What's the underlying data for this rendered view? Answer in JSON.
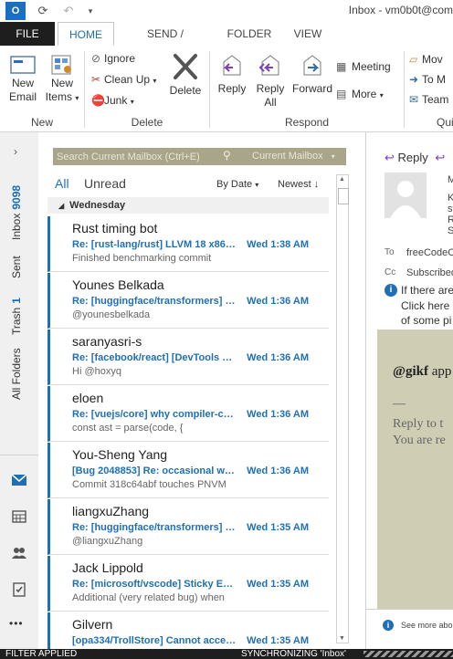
{
  "window": {
    "title": "Inbox - vm0b0t@com"
  },
  "tabs": [
    {
      "label": "FILE"
    },
    {
      "label": "HOME"
    },
    {
      "label": "SEND / RECEIVE"
    },
    {
      "label": "FOLDER"
    },
    {
      "label": "VIEW"
    }
  ],
  "ribbon": {
    "new_group": {
      "label": "New",
      "new_email": "New\nEmail",
      "new_email_l1": "New",
      "new_email_l2": "Email",
      "new_items_l1": "New",
      "new_items_l2": "Items"
    },
    "delete_group": {
      "label": "Delete",
      "ignore": "Ignore",
      "clean_up": "Clean Up",
      "junk": "Junk",
      "delete": "Delete"
    },
    "respond_group": {
      "label": "Respond",
      "reply": "Reply",
      "reply_all_l1": "Reply",
      "reply_all_l2": "All",
      "forward": "Forward",
      "meeting": "Meeting",
      "more": "More"
    },
    "quick_group": {
      "label": "Qui",
      "move": "Mov",
      "to_m": "To M",
      "team": "Team"
    }
  },
  "nav": {
    "inbox": {
      "label": "Inbox",
      "count": "9098"
    },
    "sent": {
      "label": "Sent"
    },
    "trash": {
      "label": "Trash",
      "count": "1"
    },
    "all_folders": {
      "label": "All Folders"
    },
    "more": "•••"
  },
  "list": {
    "search_placeholder": "Search Current Mailbox (Ctrl+E)",
    "scope": "Current Mailbox",
    "filter_all": "All",
    "filter_unread": "Unread",
    "sort_by": "By Date",
    "sort_order": "Newest",
    "group_header": "Wednesday",
    "messages": [
      {
        "from": "Rust timing bot",
        "subject": "Re: [rust-lang/rust] LLVM 18 x86 ...",
        "time": "Wed 1:38 AM",
        "preview": "Finished benchmarking commit"
      },
      {
        "from": "Younes Belkada",
        "subject": "Re: [huggingface/transformers] [`...",
        "time": "Wed 1:36 AM",
        "preview": "@younesbelkada"
      },
      {
        "from": "saranyasri-s",
        "subject": "Re: [facebook/react] [DevTools B...",
        "time": "Wed 1:36 AM",
        "preview": "Hi @hoxyq"
      },
      {
        "from": "eloen",
        "subject": "Re: [vuejs/core] why compiler-cor...",
        "time": "Wed 1:36 AM",
        "preview": "const ast = parse(code, {"
      },
      {
        "from": "You-Sheng Yang",
        "subject": "[Bug 2048853] Re: occasional wifi...",
        "time": "Wed 1:36 AM",
        "preview": "Commit 318c64abf touches PNVM"
      },
      {
        "from": "liangxuZhang",
        "subject": "Re: [huggingface/transformers] F...",
        "time": "Wed 1:35 AM",
        "preview": "@liangxuZhang"
      },
      {
        "from": "Jack Lippold",
        "subject": "Re: [microsoft/vscode] Sticky Edit...",
        "time": "Wed 1:35 AM",
        "preview": "Additional (very related bug) when"
      },
      {
        "from": "Gilvern",
        "subject": "[opa334/TrollStore] Cannot acces...",
        "time": "Wed 1:35 AM",
        "preview": ""
      }
    ]
  },
  "reading": {
    "reply": "Reply",
    "to_label": "To",
    "to_value": "freeCodeC",
    "cc_label": "Cc",
    "cc_value": "Subscribed",
    "info_l1": "If there are",
    "info_l2": "Click here t",
    "info_l3": "of some pi",
    "body_mention": "@gikf",
    "body_after": "app",
    "quote_l1": "Reply to t",
    "quote_l2": "You are re",
    "dash": "—",
    "see_more": "See more abou",
    "header_m": "M",
    "header_k": "K",
    "header_st": "st",
    "header_r": "R",
    "header_s": "S"
  },
  "status": {
    "filter": "FILTER APPLIED",
    "sync": "SYNCHRONIZING 'Inbox'"
  },
  "colors": {
    "accent": "#1f6fb5",
    "search_bg": "#a9a588",
    "reading_bg": "#cfcdb4"
  }
}
